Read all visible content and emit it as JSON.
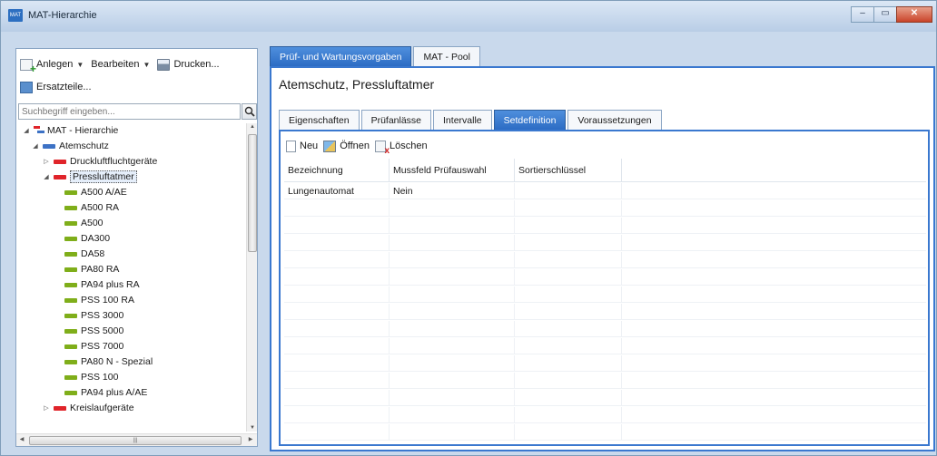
{
  "window": {
    "title": "MAT-Hierarchie",
    "icon_text": "MAT"
  },
  "left": {
    "toolbar": {
      "anlegen": "Anlegen",
      "bearbeiten": "Bearbeiten",
      "drucken": "Drucken...",
      "ersatzteile": "Ersatzteile..."
    },
    "search_placeholder": "Suchbegriff eingeben...",
    "tree": [
      {
        "label": "MAT - Hierarchie",
        "level": 0,
        "expander": "◢",
        "marker": "root"
      },
      {
        "label": "Atemschutz",
        "level": 1,
        "expander": "◢",
        "marker": "blue"
      },
      {
        "label": "Druckluftfluchtgeräte",
        "level": 2,
        "expander": "▷",
        "marker": "red"
      },
      {
        "label": "Pressluftatmer",
        "level": 2,
        "expander": "◢",
        "marker": "red",
        "selected": true
      },
      {
        "label": "A500 A/AE",
        "level": 3,
        "marker": "green"
      },
      {
        "label": "A500 RA",
        "level": 3,
        "marker": "green"
      },
      {
        "label": "A500",
        "level": 3,
        "marker": "green"
      },
      {
        "label": "DA300",
        "level": 3,
        "marker": "green"
      },
      {
        "label": "DA58",
        "level": 3,
        "marker": "green"
      },
      {
        "label": "PA80 RA",
        "level": 3,
        "marker": "green"
      },
      {
        "label": "PA94 plus RA",
        "level": 3,
        "marker": "green"
      },
      {
        "label": "PSS 100 RA",
        "level": 3,
        "marker": "green"
      },
      {
        "label": "PSS 3000",
        "level": 3,
        "marker": "green"
      },
      {
        "label": "PSS 5000",
        "level": 3,
        "marker": "green"
      },
      {
        "label": "PSS 7000",
        "level": 3,
        "marker": "green"
      },
      {
        "label": "PA80 N - Spezial",
        "level": 3,
        "marker": "green"
      },
      {
        "label": "PSS 100",
        "level": 3,
        "marker": "green"
      },
      {
        "label": "PA94 plus A/AE",
        "level": 3,
        "marker": "green"
      },
      {
        "label": "Kreislaufgeräte",
        "level": 2,
        "expander": "▷",
        "marker": "red"
      }
    ]
  },
  "right": {
    "outer_tabs": [
      {
        "label": "Prüf- und Wartungsvorgaben",
        "active": true
      },
      {
        "label": "MAT - Pool",
        "active": false
      }
    ],
    "object_title": "Atemschutz, Pressluftatmer",
    "inner_tabs": [
      {
        "label": "Eigenschaften",
        "active": false
      },
      {
        "label": "Prüfanlässe",
        "active": false
      },
      {
        "label": "Intervalle",
        "active": false
      },
      {
        "label": "Setdefinition",
        "active": true
      },
      {
        "label": "Voraussetzungen",
        "active": false
      }
    ],
    "toolbar": {
      "neu": "Neu",
      "oeffnen": "Öffnen",
      "loeschen": "Löschen"
    },
    "table": {
      "columns": [
        "Bezeichnung",
        "Mussfeld Prüfauswahl",
        "Sortierschlüssel",
        ""
      ],
      "rows": [
        [
          "Lungenautomat",
          "Nein",
          "",
          ""
        ]
      ],
      "empty_rows": 14
    }
  },
  "colors": {
    "accent": "#3a78cf",
    "active_tab": "#2c6cc4",
    "red_marker": "#e0242a",
    "green_marker": "#7fae1a",
    "blue_marker": "#3d72c5"
  }
}
